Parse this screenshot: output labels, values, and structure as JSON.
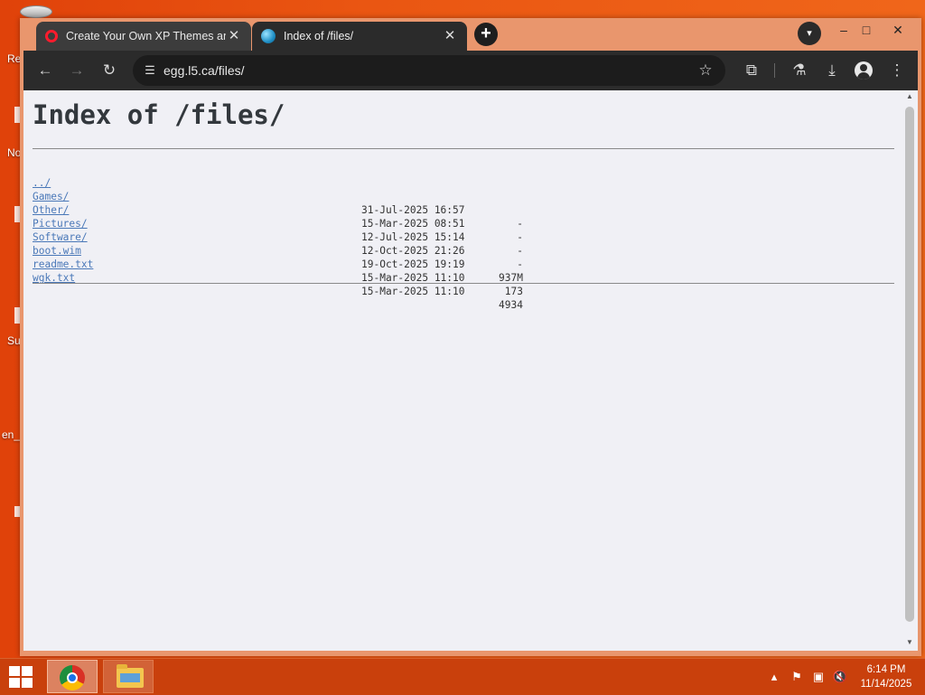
{
  "desktop": {
    "fragments": [
      "Re",
      "No",
      "Su",
      "en_"
    ]
  },
  "browser": {
    "tabs": [
      {
        "title": "Create Your Own XP Themes an",
        "icon": "opera-icon",
        "active": false
      },
      {
        "title": "Index of /files/",
        "icon": "globe-icon",
        "active": true
      }
    ],
    "new_tab_label": "+",
    "address": "egg.l5.ca/files/",
    "window_controls": [
      "–",
      "□",
      "✕"
    ]
  },
  "page": {
    "heading": "Index of /files/",
    "parent_link": "../",
    "entries": [
      {
        "name": "Games/",
        "date": "31-Jul-2025 16:57",
        "size": "-"
      },
      {
        "name": "Other/",
        "date": "15-Mar-2025 08:51",
        "size": "-"
      },
      {
        "name": "Pictures/",
        "date": "12-Jul-2025 15:14",
        "size": "-"
      },
      {
        "name": "Software/",
        "date": "12-Oct-2025 21:26",
        "size": "-"
      },
      {
        "name": "boot.wim",
        "date": "19-Oct-2025 19:19",
        "size": "937M"
      },
      {
        "name": "readme.txt",
        "date": "15-Mar-2025 11:10",
        "size": "173"
      },
      {
        "name": "wgk.txt",
        "date": "15-Mar-2025 11:10",
        "size": "4934"
      }
    ]
  },
  "taskbar": {
    "time": "6:14 PM",
    "date": "11/14/2025",
    "apps": [
      "chrome-icon",
      "file-explorer-icon"
    ]
  },
  "colors": {
    "desktop_bg": "#e9520f",
    "link": "#4a78b8",
    "page_bg": "#f0f0f5",
    "toolbar": "#2b2b2b"
  }
}
